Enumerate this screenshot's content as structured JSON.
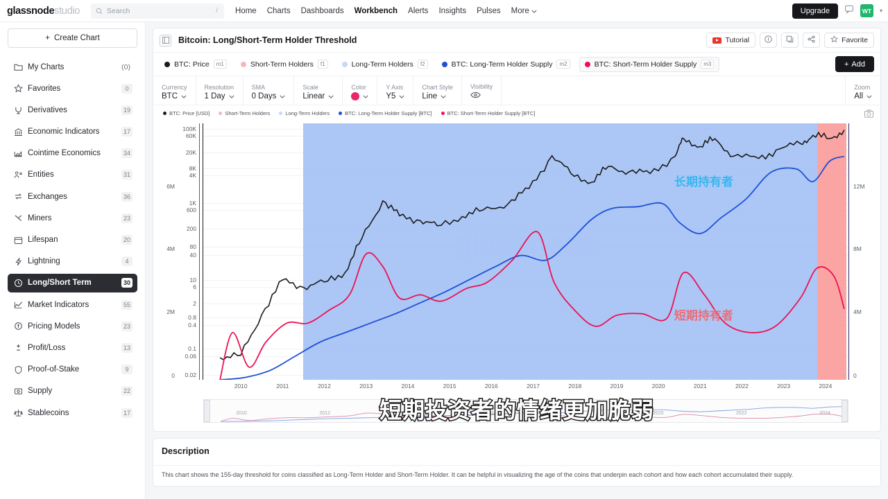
{
  "topnav": {
    "brand_primary": "glassnode",
    "brand_secondary": "studio",
    "search_placeholder": "Search",
    "search_shortcut": "/",
    "links": [
      {
        "label": "Home",
        "active": false
      },
      {
        "label": "Charts",
        "active": false
      },
      {
        "label": "Dashboards",
        "active": false
      },
      {
        "label": "Workbench",
        "active": true
      },
      {
        "label": "Alerts",
        "active": false
      },
      {
        "label": "Insights",
        "active": false
      },
      {
        "label": "Pulses",
        "active": false
      }
    ],
    "more_label": "More",
    "upgrade_label": "Upgrade",
    "avatar_initials": "WT"
  },
  "sidebar": {
    "create_chart_label": "Create Chart",
    "items": [
      {
        "label": "My Charts",
        "count": "(0)",
        "icon": "folder-icon",
        "plain": true,
        "active": false
      },
      {
        "label": "Favorites",
        "count": "0",
        "icon": "star-icon",
        "active": false
      },
      {
        "label": "Derivatives",
        "count": "19",
        "icon": "derivatives-icon",
        "active": false
      },
      {
        "label": "Economic Indicators",
        "count": "17",
        "icon": "bank-icon",
        "active": false
      },
      {
        "label": "Cointime Economics",
        "count": "34",
        "icon": "area-chart-icon",
        "active": false
      },
      {
        "label": "Entities",
        "count": "31",
        "icon": "people-icon",
        "active": false
      },
      {
        "label": "Exchanges",
        "count": "36",
        "icon": "exchange-icon",
        "active": false
      },
      {
        "label": "Miners",
        "count": "23",
        "icon": "pickaxe-icon",
        "active": false
      },
      {
        "label": "Lifespan",
        "count": "20",
        "icon": "calendar-icon",
        "active": false
      },
      {
        "label": "Lightning",
        "count": "4",
        "icon": "lightning-icon",
        "active": false
      },
      {
        "label": "Long/Short Term",
        "count": "30",
        "icon": "clock-icon",
        "active": true
      },
      {
        "label": "Market Indicators",
        "count": "55",
        "icon": "line-chart-icon",
        "active": false
      },
      {
        "label": "Pricing Models",
        "count": "23",
        "icon": "coin-icon",
        "active": false
      },
      {
        "label": "Profit/Loss",
        "count": "13",
        "icon": "plusminus-icon",
        "active": false
      },
      {
        "label": "Proof-of-Stake",
        "count": "9",
        "icon": "shield-icon",
        "active": false
      },
      {
        "label": "Supply",
        "count": "22",
        "icon": "supply-icon",
        "active": false
      },
      {
        "label": "Stablecoins",
        "count": "17",
        "icon": "scales-icon",
        "active": false
      }
    ]
  },
  "chart_header": {
    "title": "Bitcoin: Long/Short-Term Holder Threshold",
    "tutorial_label": "Tutorial",
    "favorite_label": "Favorite"
  },
  "metrics": [
    {
      "label": "BTC: Price",
      "kbd": "m1",
      "color": "#1a1a1a",
      "selected": false
    },
    {
      "label": "Short-Term Holders",
      "kbd": "f1",
      "color": "#f5b7bd",
      "selected": false
    },
    {
      "label": "Long-Term Holders",
      "kbd": "f2",
      "color": "#c5d8f7",
      "selected": false
    },
    {
      "label": "BTC: Long-Term Holder Supply",
      "kbd": "m2",
      "color": "#1d4fd8",
      "selected": false
    },
    {
      "label": "BTC: Short-Term Holder Supply",
      "kbd": "m3",
      "color": "#ec1152",
      "selected": true
    }
  ],
  "add_button_label": "Add",
  "controls": [
    {
      "label": "Currency",
      "value": "BTC",
      "type": "select"
    },
    {
      "label": "Resolution",
      "value": "1 Day",
      "type": "select"
    },
    {
      "label": "SMA",
      "value": "0 Days",
      "type": "select"
    },
    {
      "label": "Scale",
      "value": "Linear",
      "type": "select"
    },
    {
      "label": "Color",
      "value": "",
      "type": "color",
      "color": "#e8276a"
    },
    {
      "label": "Y Axis",
      "value": "Y5",
      "type": "select"
    },
    {
      "label": "Chart Style",
      "value": "Line",
      "type": "select"
    },
    {
      "label": "Visibility",
      "value": "",
      "type": "eye"
    }
  ],
  "zoom_control": {
    "label": "Zoom",
    "value": "All"
  },
  "overlay_subtitle": "短期投资者的情绪更加脆弱",
  "description": {
    "title": "Description",
    "text": "This chart shows the 155-day threshold for coins classified as Long-Term Holder and Short-Term Holder. It can be helpful in visualizing the age of the coins that underpin each cohort and how each cohort accumulated their supply."
  },
  "chart_data": {
    "type": "line",
    "title": "Bitcoin: Long/Short-Term Holder Threshold",
    "xlabel": "",
    "ylabel": "",
    "grid": true,
    "legend_position": "top-left",
    "legend": [
      {
        "name": "BTC: Price [USD]",
        "color": "#1a1a1a"
      },
      {
        "name": "Short-Term Holders",
        "color": "#f5b7bd"
      },
      {
        "name": "Long-Term Holders",
        "color": "#c5d8f7"
      },
      {
        "name": "BTC: Long-Term Holder Supply [BTC]",
        "color": "#1d4fd8"
      },
      {
        "name": "BTC: Short-Term Holder Supply [BTC]",
        "color": "#ec1152"
      }
    ],
    "x_ticks": [
      "2010",
      "2011",
      "2012",
      "2013",
      "2014",
      "2015",
      "2016",
      "2017",
      "2018",
      "2019",
      "2020",
      "2021",
      "2022",
      "2023",
      "2024"
    ],
    "y_left_outer_ticks": [
      "6M",
      "4M",
      "2M",
      "0"
    ],
    "y_left_inner_ticks": [
      "100K",
      "60K",
      "20K",
      "8K",
      "4K",
      "1K",
      "600",
      "200",
      "80",
      "40",
      "10",
      "6",
      "2",
      "0.8",
      "0.4",
      "0.1",
      "0.06",
      "0.02"
    ],
    "y_right_ticks": [
      "12M",
      "8M",
      "4M",
      "0"
    ],
    "y_left_inner_scale": "log",
    "y_left_inner_label": "BTC: Price [USD]",
    "y_right_label": "Supply [BTC]",
    "annotations": [
      {
        "text": "长期持有者",
        "color": "#3bb6f0",
        "meaning": "Long-Term Holders"
      },
      {
        "text": "短期持有者",
        "color": "#ec6d7a",
        "meaning": "Short-Term Holders"
      }
    ],
    "watermark": "glassnode",
    "series": [
      {
        "name": "BTC: Price [USD]",
        "color": "#1a1a1a",
        "axis": "left-log",
        "x": [
          2010.0,
          2010.5,
          2011.0,
          2011.5,
          2012.0,
          2012.5,
          2013.0,
          2013.4,
          2013.9,
          2014.3,
          2014.8,
          2015.2,
          2015.8,
          2016.3,
          2016.9,
          2017.4,
          2017.95,
          2018.4,
          2018.9,
          2019.3,
          2019.8,
          2020.3,
          2020.9,
          2021.1,
          2021.5,
          2021.85,
          2022.3,
          2022.9,
          2023.4,
          2023.9,
          2024.2,
          2024.6,
          2024.95
        ],
        "y": [
          0.06,
          0.07,
          0.9,
          8,
          5,
          7,
          13,
          110,
          1150,
          450,
          330,
          240,
          430,
          650,
          960,
          2500,
          19500,
          6500,
          3700,
          10000,
          7200,
          6400,
          19000,
          58000,
          35000,
          57000,
          19000,
          16500,
          30000,
          42000,
          71000,
          58000,
          99000
        ]
      },
      {
        "name": "BTC: Long-Term Holder Supply [BTC]",
        "color": "#1d4fd8",
        "axis": "right",
        "x": [
          2010.0,
          2010.6,
          2011.2,
          2011.8,
          2012.4,
          2013.0,
          2013.6,
          2014.2,
          2014.8,
          2015.4,
          2016.0,
          2016.6,
          2017.2,
          2017.8,
          2018.3,
          2018.9,
          2019.4,
          2020.0,
          2020.6,
          2021.0,
          2021.5,
          2022.0,
          2022.6,
          2023.2,
          2023.8,
          2024.2,
          2024.6,
          2024.95
        ],
        "y": [
          0.0,
          0.15,
          0.6,
          1.5,
          2.4,
          3.0,
          3.6,
          4.2,
          4.9,
          5.6,
          6.4,
          7.2,
          7.9,
          7.6,
          8.6,
          10.2,
          10.9,
          11.0,
          11.2,
          10.0,
          9.3,
          10.3,
          11.5,
          13.2,
          13.4,
          12.6,
          13.9,
          14.2
        ]
      },
      {
        "name": "BTC: Short-Term Holder Supply [BTC]",
        "color": "#ec1152",
        "axis": "right",
        "x": [
          2010.0,
          2010.3,
          2010.7,
          2011.1,
          2011.6,
          2012.1,
          2012.6,
          2013.1,
          2013.5,
          2013.9,
          2014.3,
          2014.8,
          2015.3,
          2015.9,
          2016.4,
          2017.0,
          2017.6,
          2018.0,
          2018.5,
          2019.0,
          2019.5,
          2020.1,
          2020.7,
          2021.1,
          2021.6,
          2022.1,
          2022.7,
          2023.3,
          2023.9,
          2024.3,
          2024.7,
          2024.95
        ],
        "y": [
          0.0,
          3.0,
          0.8,
          2.4,
          3.6,
          3.6,
          4.4,
          5.4,
          8.0,
          7.2,
          5.2,
          5.4,
          5.0,
          5.8,
          6.2,
          7.6,
          9.4,
          6.2,
          4.4,
          3.4,
          4.1,
          4.2,
          3.9,
          6.8,
          5.4,
          3.6,
          3.0,
          3.4,
          5.2,
          7.1,
          6.6,
          4.5
        ]
      }
    ],
    "shaded_regions": [
      {
        "label": "Long-Term Holders",
        "color": "#9dbdf5",
        "from": 2012.0,
        "to": 2024.3
      },
      {
        "label": "Short-Term Holders",
        "color": "#fb9a9a",
        "from": 2024.3,
        "to": 2025.0
      }
    ]
  }
}
